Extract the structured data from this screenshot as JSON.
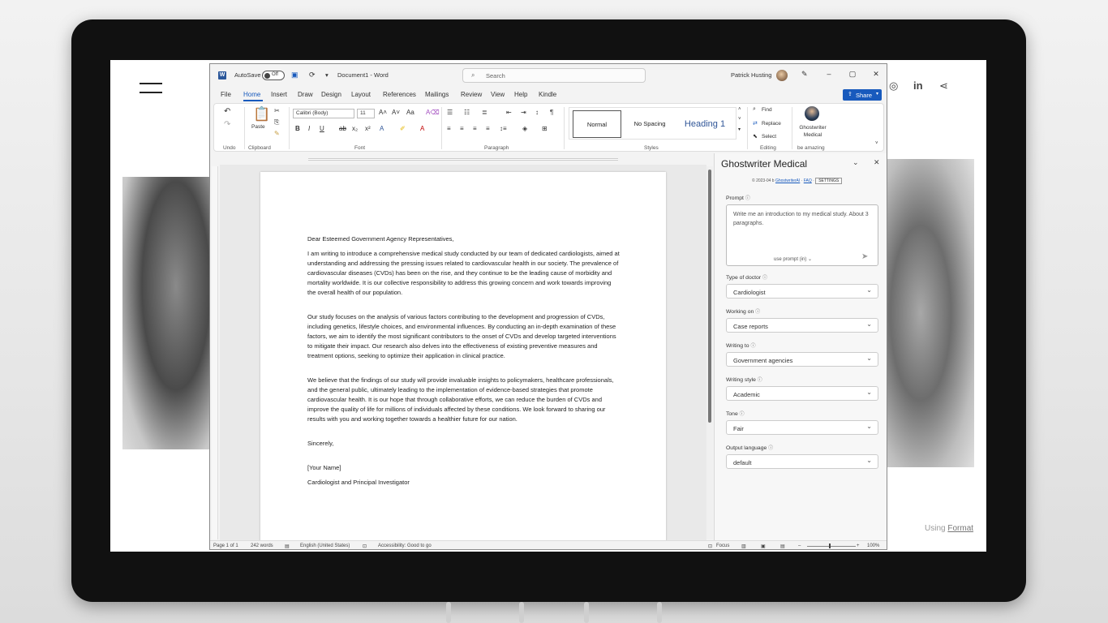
{
  "site": {
    "social": [
      "◎",
      "in",
      "⋖"
    ],
    "footer_prefix": "Using ",
    "footer_link": "Format"
  },
  "word": {
    "autosave_label": "AutoSave",
    "autosave_state": "Off",
    "doc_title": "Document1 - Word",
    "search_placeholder": "Search",
    "user_name": "Patrick Husting",
    "menu": [
      "File",
      "Home",
      "Insert",
      "Draw",
      "Design",
      "Layout",
      "References",
      "Mailings",
      "Review",
      "View",
      "Help",
      "Kindle"
    ],
    "share_label": "Share",
    "ribbon": {
      "undo_label": "Undo",
      "paste_label": "Paste",
      "clipboard_label": "Clipboard",
      "font_name": "Calibri (Body)",
      "font_size": "11",
      "font_label": "Font",
      "paragraph_label": "Paragraph",
      "styles": [
        "Normal",
        "No Spacing",
        "Heading 1"
      ],
      "styles_label": "Styles",
      "find_label": "Find",
      "replace_label": "Replace",
      "select_label": "Select",
      "editing_label": "Editing",
      "ghostwriter_label": "Ghostwriter Medical",
      "be_amazing_label": "be amazing"
    },
    "document": {
      "salutation": "Dear Esteemed Government Agency Representatives,",
      "paragraphs": [
        "I am writing to introduce a comprehensive medical study conducted by our team of dedicated cardiologists, aimed at understanding and addressing the pressing issues related to cardiovascular health in our society. The prevalence of cardiovascular diseases (CVDs) has been on the rise, and they continue to be the leading cause of morbidity and mortality worldwide. It is our collective responsibility to address this growing concern and work towards improving the overall health of our population.",
        "Our study focuses on the analysis of various factors contributing to the development and progression of CVDs, including genetics, lifestyle choices, and environmental influences. By conducting an in-depth examination of these factors, we aim to identify the most significant contributors to the onset of CVDs and develop targeted interventions to mitigate their impact. Our research also delves into the effectiveness of existing preventive measures and treatment options, seeking to optimize their application in clinical practice.",
        "We believe that the findings of our study will provide invaluable insights to policymakers, healthcare professionals, and the general public, ultimately leading to the implementation of evidence-based strategies that promote cardiovascular health. It is our hope that through collaborative efforts, we can reduce the burden of CVDs and improve the quality of life for millions of individuals affected by these conditions. We look forward to sharing our results with you and working together towards a healthier future for our nation."
      ],
      "closing": "Sincerely,",
      "name_placeholder": "[Your Name]",
      "title_line": "Cardiologist and Principal Investigator"
    },
    "status": {
      "page": "Page 1 of 1",
      "words": "242 words",
      "language": "English (United States)",
      "accessibility": "Accessibility: Good to go",
      "focus": "Focus",
      "zoom": "100%"
    }
  },
  "pane": {
    "title": "Ghostwriter Medical",
    "copyright": "© 2023-04 b ",
    "copyright_link": "GhostwriterAI",
    "faq": "FAQ",
    "settings": "SETTINGS",
    "prompt_label": "Prompt",
    "prompt_value": "Write me an introduction to my medical study.  About 3 paragraphs.",
    "prompt_template": "use prompt (in) ⌄",
    "fields": [
      {
        "label": "Type of doctor",
        "value": "Cardiologist"
      },
      {
        "label": "Working on",
        "value": "Case reports"
      },
      {
        "label": "Writing to",
        "value": "Government agencies"
      },
      {
        "label": "Writing style",
        "value": "Academic"
      },
      {
        "label": "Tone",
        "value": "Fair"
      },
      {
        "label": "Output language",
        "value": "default"
      }
    ]
  }
}
